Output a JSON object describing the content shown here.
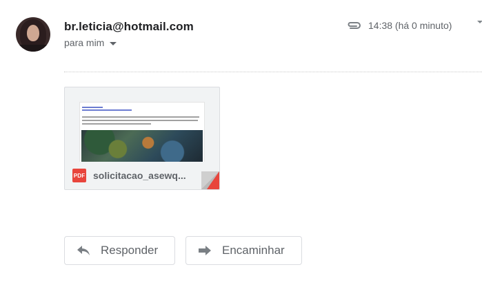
{
  "sender": {
    "email": "br.leticia@hotmail.com",
    "recipient_label": "para mim"
  },
  "meta": {
    "attachment_icon": "paperclip-icon",
    "time": "14:38 (há 0 minuto)"
  },
  "attachment": {
    "type_badge": "PDF",
    "filename": "solicitacao_asewq...",
    "preview_text": [
      "Olá, asewqqweqwe",
      "seu email: teleoshwaqq@gmail.com",
      "Lorem, ipsum dolor sit amet consectetur adipisicing elit. Minima et gendi odio harum",
      "sed, pariatur quos quas veniam tinetam quis hic blandiitis quasi rum quaerat eaque",
      "nulla corpore, voluptatem crsepture earum."
    ]
  },
  "actions": {
    "reply_label": "Responder",
    "reply_icon": "reply-arrow-icon",
    "forward_label": "Encaminhar",
    "forward_icon": "forward-arrow-icon"
  },
  "colors": {
    "pdf_red": "#e8453c",
    "text_dark": "#202124",
    "text_muted": "#5f6368"
  }
}
